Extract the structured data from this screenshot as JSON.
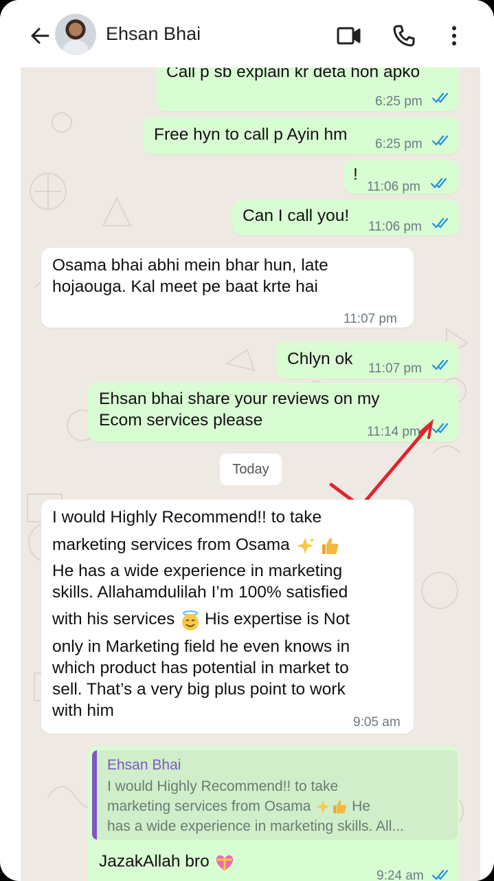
{
  "header": {
    "contact_name": "Ehsan Bhai",
    "icons": [
      "back-arrow-icon",
      "video-call-icon",
      "voice-call-icon",
      "more-vert-icon"
    ]
  },
  "colors": {
    "outgoing_bubble": "#d9fdd3",
    "incoming_bubble": "#ffffff",
    "chat_bg": "#efe9e3",
    "read_tick": "#1d8fe0",
    "quote_author": "#7e57c2",
    "annotation_check": "#e0242e"
  },
  "messages": [
    {
      "dir": "out",
      "lines": [
        "Call p sb explain kr deta hon apko"
      ],
      "time": "6:25 pm",
      "ticks": "read"
    },
    {
      "dir": "out",
      "lines": [
        "Free hyn to call p Ayin hm"
      ],
      "time": "6:25 pm",
      "ticks": "read"
    },
    {
      "dir": "out",
      "lines": [
        "!"
      ],
      "time": "11:06 pm",
      "ticks": "read"
    },
    {
      "dir": "out",
      "lines": [
        "Can I call you!"
      ],
      "time": "11:06 pm",
      "ticks": "read"
    },
    {
      "dir": "in",
      "lines": [
        "Osama bhai abhi mein bhar hun, late",
        "hojaouga. Kal meet pe baat krte hai"
      ],
      "time": "11:07 pm"
    },
    {
      "dir": "out",
      "lines": [
        "Chlyn ok"
      ],
      "time": "11:07 pm",
      "ticks": "read"
    },
    {
      "dir": "out",
      "lines": [
        "Ehsan bhai share your reviews on my",
        "Ecom services please"
      ],
      "time": "11:14 pm",
      "ticks": "read"
    },
    {
      "dir": "in",
      "lines": [
        "I would Highly Recommend!! to take",
        "marketing services from Osama",
        "He has a wide experience in marketing",
        "skills. Allahamdulilah I’m 100% satisfied",
        "with his services",
        "His expertise is Not",
        "only in Marketing field he even knows in",
        "which product has potential in market to",
        "sell. That’s a very big plus point to work",
        "with him"
      ],
      "time": "9:05 am",
      "emojis": [
        "sparkles",
        "thumbs-up",
        "smiling-face-with-halo"
      ]
    },
    {
      "dir": "out",
      "quote": {
        "author": "Ehsan Bhai",
        "lines": [
          "I would Highly Recommend!! to take",
          "marketing services from Osama",
          "He",
          "has a wide experience in marketing skills. All..."
        ]
      },
      "lines": [
        "JazakAllah bro"
      ],
      "time": "9:24 am",
      "ticks": "read",
      "emojis": [
        "heart-with-ribbon"
      ]
    }
  ],
  "date_separator": "Today"
}
